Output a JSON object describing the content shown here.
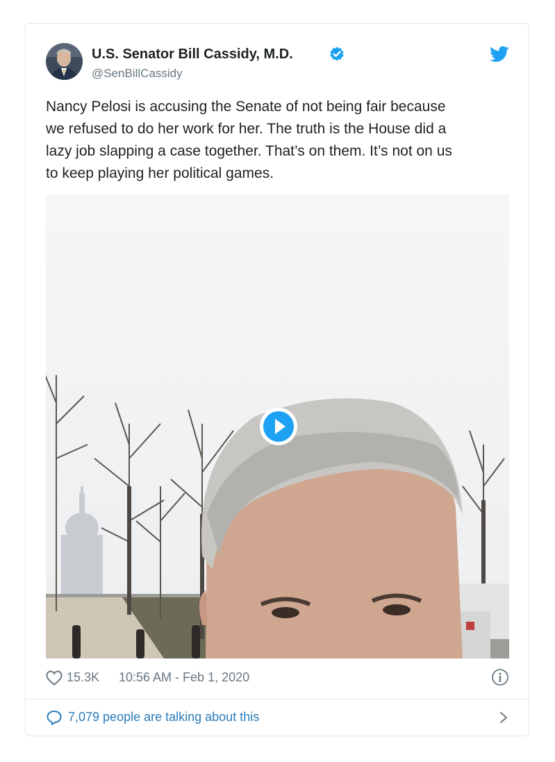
{
  "tweet": {
    "author_name": "U.S. Senator Bill Cassidy, M.D.",
    "handle": "@SenBillCassidy",
    "text": "Nancy Pelosi is accusing the Senate of not being fair because\nwe refused to do her work for her. The truth is the House did a\nlazy job slapping a case together. That’s on them. It’s not on us\nto keep playing her political games.",
    "likes": "15.3K",
    "timestamp": "10:56 AM - Feb 1, 2020",
    "talking_label": "7,079 people are talking about this"
  },
  "icons": {
    "avatar": "avatar-image",
    "verified": "verified-badge-icon",
    "brand": "twitter-bird-icon",
    "heart": "heart-icon",
    "info": "info-icon",
    "bubble": "speech-bubble-icon",
    "chevron": "chevron-right-icon",
    "play": "play-icon"
  },
  "colors": {
    "accent": "#1da1f2",
    "link": "#2b7bb9",
    "muted": "#697882",
    "text": "#1c2022",
    "border": "#e1e8ed"
  }
}
